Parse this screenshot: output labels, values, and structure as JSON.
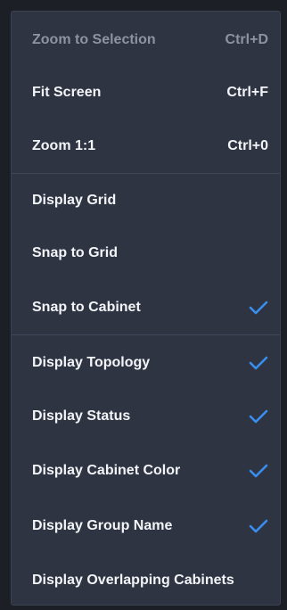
{
  "colors": {
    "background": "#2e3442",
    "text": "#f2f4f7",
    "disabled_text": "#8d939f",
    "check": "#3a8ef0",
    "divider": "#40475a"
  },
  "menu": {
    "zoom_group": [
      {
        "label": "Zoom to Selection",
        "shortcut": "Ctrl+D",
        "enabled": false
      },
      {
        "label": "Fit Screen",
        "shortcut": "Ctrl+F",
        "enabled": true
      },
      {
        "label": "Zoom 1:1",
        "shortcut": "Ctrl+0",
        "enabled": true
      }
    ],
    "grid_group": [
      {
        "label": "Display Grid",
        "checked": false
      },
      {
        "label": "Snap to Grid",
        "checked": false
      },
      {
        "label": "Snap to Cabinet",
        "checked": true,
        "icon": "checkmark-icon"
      }
    ],
    "display_group": [
      {
        "label": "Display Topology",
        "checked": true,
        "icon": "checkmark-icon"
      },
      {
        "label": "Display Status",
        "checked": true,
        "icon": "checkmark-icon"
      },
      {
        "label": "Display Cabinet Color",
        "checked": true,
        "icon": "checkmark-icon"
      },
      {
        "label": "Display Group Name",
        "checked": true,
        "icon": "checkmark-icon"
      },
      {
        "label": "Display Overlapping Cabinets",
        "checked": false
      }
    ]
  }
}
